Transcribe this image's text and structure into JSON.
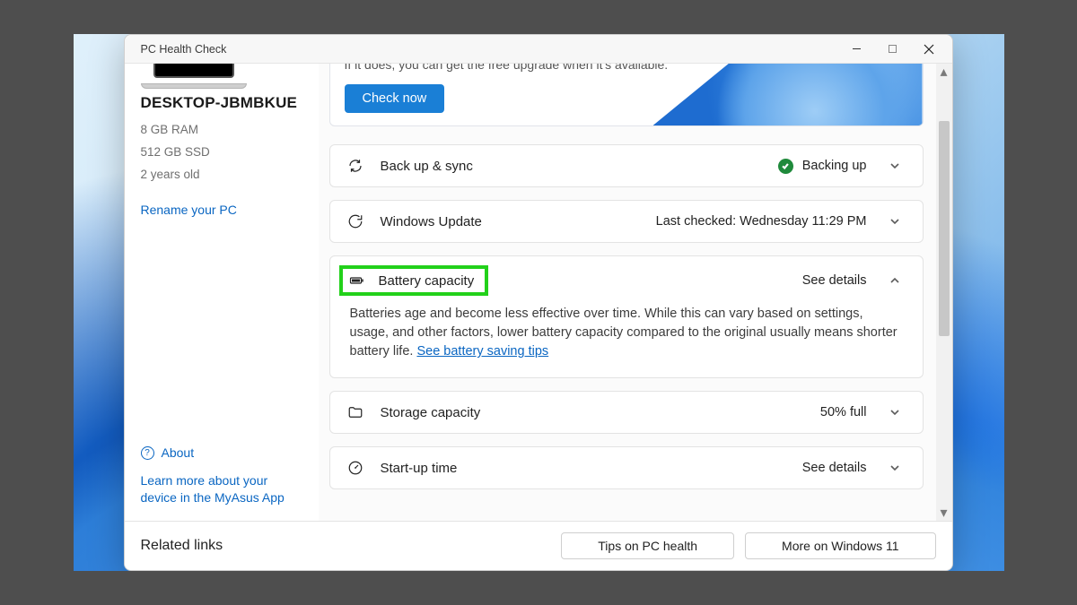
{
  "window": {
    "title": "PC Health Check"
  },
  "sidebar": {
    "device_name": "DESKTOP-JBMBKUE",
    "ram": "8 GB RAM",
    "storage": "512 GB SSD",
    "age": "2 years old",
    "rename_link": "Rename your PC",
    "about": "About",
    "learn_more": "Learn more about your device in the MyAsus App"
  },
  "banner": {
    "text": "If it does, you can get the free upgrade when it's available.",
    "button": "Check now"
  },
  "cards": {
    "backup": {
      "title": "Back up & sync",
      "status": "Backing up"
    },
    "update": {
      "title": "Windows Update",
      "status": "Last checked: Wednesday 11:29 PM"
    },
    "battery": {
      "title": "Battery capacity",
      "action": "See details",
      "body_text": "Batteries age and become less effective over time. While this can vary based on settings, usage, and other factors, lower battery capacity compared to the original usually means shorter battery life. ",
      "body_link": "See battery saving tips"
    },
    "storage": {
      "title": "Storage capacity",
      "status": "50% full"
    },
    "startup": {
      "title": "Start-up time",
      "action": "See details"
    }
  },
  "footer": {
    "label": "Related links",
    "tips": "Tips on PC health",
    "more": "More on Windows 11"
  }
}
